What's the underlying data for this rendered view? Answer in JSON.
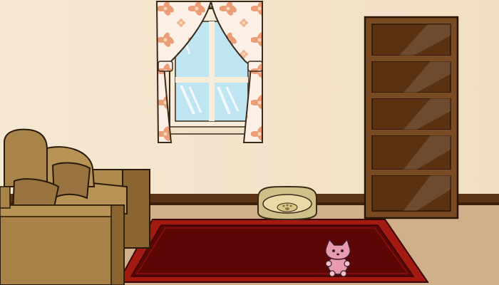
{
  "scene": {
    "name": "living-room",
    "colors": {
      "wall": "#f4e5cc",
      "wall_shadow": "#ecd6b6",
      "baseboard": "#5c3416",
      "floor": "#cfb08a",
      "floor_dark": "#c09c74",
      "window_sky": "#bfe4f2",
      "window_frame": "#f6ecd8",
      "curtain": "#fbefe6",
      "flower": "#e8956a",
      "bookcase": "#7a4a22",
      "bookcase_dark": "#5a3212",
      "sofa": "#b08a4c",
      "sofa_dark": "#8a6530",
      "rug_outer": "#a31a12",
      "rug_inner": "#5c0606",
      "rug_fringe": "#c8a55a",
      "pet_bed": "#cfc08a",
      "pet_bed_inner": "#e8dba8",
      "toy": "#e79ab0"
    },
    "objects": [
      {
        "id": "window",
        "icon": "window-icon"
      },
      {
        "id": "bookcase",
        "icon": "bookcase-icon"
      },
      {
        "id": "sofa",
        "icon": "sofa-icon"
      },
      {
        "id": "pet-bed",
        "icon": "pet-bed-icon"
      },
      {
        "id": "rug",
        "icon": "rug-icon"
      },
      {
        "id": "cat-toy",
        "icon": "cat-plush-icon"
      }
    ]
  }
}
